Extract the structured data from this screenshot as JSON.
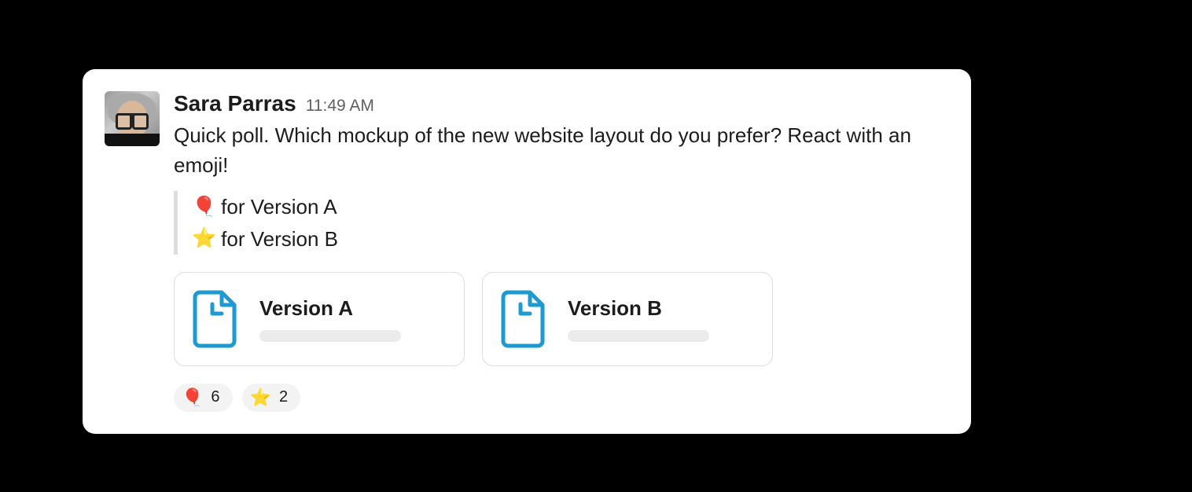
{
  "message": {
    "author": "Sara Parras",
    "timestamp": "11:49 AM",
    "body": "Quick poll. Which mockup of the new website layout do you prefer? React with an emoji!",
    "poll_options": [
      {
        "emoji": "🎈",
        "label": "for Version A"
      },
      {
        "emoji": "⭐",
        "label": "for Version B"
      }
    ],
    "attachments": [
      {
        "title": "Version A"
      },
      {
        "title": "Version B"
      }
    ],
    "reactions": [
      {
        "emoji": "🎈",
        "count": "6"
      },
      {
        "emoji": "⭐",
        "count": "2"
      }
    ]
  }
}
